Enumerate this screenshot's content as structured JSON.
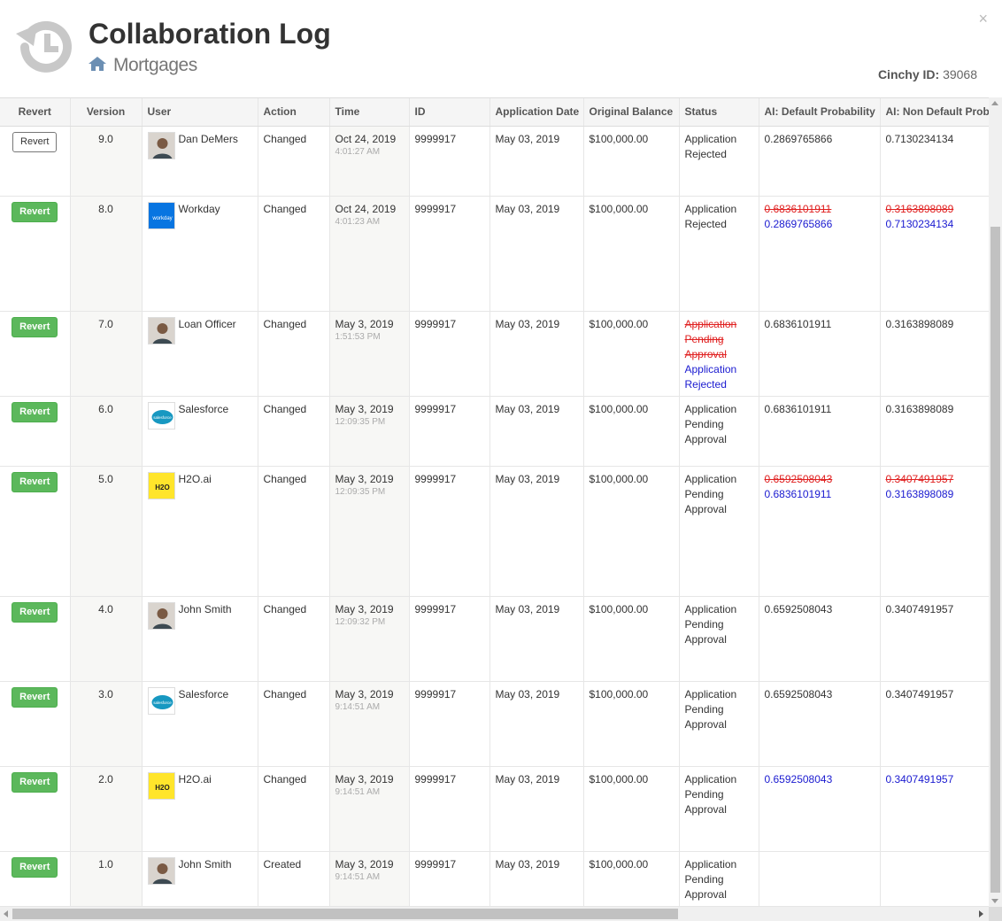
{
  "header": {
    "title": "Collaboration Log",
    "subtitle": "Mortgages",
    "close_label": "×",
    "cinchy_id_label": "Cinchy ID:",
    "cinchy_id_value": "39068"
  },
  "table": {
    "columns": [
      "Revert",
      "Version",
      "User",
      "Action",
      "Time",
      "ID",
      "Application Date",
      "Original Balance",
      "Status",
      "AI: Default Probability",
      "AI: Non Default Probability"
    ],
    "rows": [
      {
        "revert": "Revert",
        "revert_style": "default",
        "version": "9.0",
        "user": "Dan DeMers",
        "avatar": "person",
        "action": "Changed",
        "date": "Oct 24, 2019",
        "time": "4:01:27 AM",
        "id": "9999917",
        "app_date": "May 03, 2019",
        "balance": "$100,000.00",
        "status": [
          {
            "text": "Application Rejected",
            "style": "plain"
          }
        ],
        "default_prob": [
          {
            "text": "0.2869765866",
            "style": "plain"
          }
        ],
        "non_default_prob": [
          {
            "text": "0.7130234134",
            "style": "plain"
          }
        ]
      },
      {
        "revert": "Revert",
        "revert_style": "success",
        "version": "8.0",
        "user": "Workday",
        "avatar": "workday",
        "action": "Changed",
        "date": "Oct 24, 2019",
        "time": "4:01:23 AM",
        "id": "9999917",
        "app_date": "May 03, 2019",
        "balance": "$100,000.00",
        "status": [
          {
            "text": "Application Rejected",
            "style": "plain"
          }
        ],
        "default_prob": [
          {
            "text": "0.6836101911",
            "style": "old"
          },
          {
            "text": "0.2869765866",
            "style": "new"
          }
        ],
        "non_default_prob": [
          {
            "text": "0.3163898089",
            "style": "old"
          },
          {
            "text": "0.7130234134",
            "style": "new"
          }
        ]
      },
      {
        "revert": "Revert",
        "revert_style": "success",
        "version": "7.0",
        "user": "Loan Officer",
        "avatar": "person",
        "action": "Changed",
        "date": "May 3, 2019",
        "time": "1:51:53 PM",
        "id": "9999917",
        "app_date": "May 03, 2019",
        "balance": "$100,000.00",
        "status": [
          {
            "text": "Application Pending Approval",
            "style": "old"
          },
          {
            "text": "Application Rejected",
            "style": "new"
          }
        ],
        "default_prob": [
          {
            "text": "0.6836101911",
            "style": "plain"
          }
        ],
        "non_default_prob": [
          {
            "text": "0.3163898089",
            "style": "plain"
          }
        ]
      },
      {
        "revert": "Revert",
        "revert_style": "success",
        "version": "6.0",
        "user": "Salesforce",
        "avatar": "salesforce",
        "action": "Changed",
        "date": "May 3, 2019",
        "time": "12:09:35 PM",
        "id": "9999917",
        "app_date": "May 03, 2019",
        "balance": "$100,000.00",
        "status": [
          {
            "text": "Application Pending Approval",
            "style": "plain"
          }
        ],
        "default_prob": [
          {
            "text": "0.6836101911",
            "style": "plain"
          }
        ],
        "non_default_prob": [
          {
            "text": "0.3163898089",
            "style": "plain"
          }
        ]
      },
      {
        "revert": "Revert",
        "revert_style": "success",
        "version": "5.0",
        "user": "H2O.ai",
        "avatar": "h2o",
        "action": "Changed",
        "date": "May 3, 2019",
        "time": "12:09:35 PM",
        "id": "9999917",
        "app_date": "May 03, 2019",
        "balance": "$100,000.00",
        "status": [
          {
            "text": "Application Pending Approval",
            "style": "plain"
          }
        ],
        "default_prob": [
          {
            "text": "0.6592508043",
            "style": "old"
          },
          {
            "text": "0.6836101911",
            "style": "new"
          }
        ],
        "non_default_prob": [
          {
            "text": "0.3407491957",
            "style": "old"
          },
          {
            "text": "0.3163898089",
            "style": "new"
          }
        ]
      },
      {
        "revert": "Revert",
        "revert_style": "success",
        "version": "4.0",
        "user": "John Smith",
        "avatar": "person",
        "action": "Changed",
        "date": "May 3, 2019",
        "time": "12:09:32 PM",
        "id": "9999917",
        "app_date": "May 03, 2019",
        "balance": "$100,000.00",
        "status": [
          {
            "text": "Application Pending Approval",
            "style": "plain"
          }
        ],
        "default_prob": [
          {
            "text": "0.6592508043",
            "style": "plain"
          }
        ],
        "non_default_prob": [
          {
            "text": "0.3407491957",
            "style": "plain"
          }
        ]
      },
      {
        "revert": "Revert",
        "revert_style": "success",
        "version": "3.0",
        "user": "Salesforce",
        "avatar": "salesforce",
        "action": "Changed",
        "date": "May 3, 2019",
        "time": "9:14:51 AM",
        "id": "9999917",
        "app_date": "May 03, 2019",
        "balance": "$100,000.00",
        "status": [
          {
            "text": "Application Pending Approval",
            "style": "plain"
          }
        ],
        "default_prob": [
          {
            "text": "0.6592508043",
            "style": "plain"
          }
        ],
        "non_default_prob": [
          {
            "text": "0.3407491957",
            "style": "plain"
          }
        ]
      },
      {
        "revert": "Revert",
        "revert_style": "success",
        "version": "2.0",
        "user": "H2O.ai",
        "avatar": "h2o",
        "action": "Changed",
        "date": "May 3, 2019",
        "time": "9:14:51 AM",
        "id": "9999917",
        "app_date": "May 03, 2019",
        "balance": "$100,000.00",
        "status": [
          {
            "text": "Application Pending Approval",
            "style": "plain"
          }
        ],
        "default_prob": [
          {
            "text": "0.6592508043",
            "style": "new"
          }
        ],
        "non_default_prob": [
          {
            "text": "0.3407491957",
            "style": "new"
          }
        ]
      },
      {
        "revert": "Revert",
        "revert_style": "success",
        "version": "1.0",
        "user": "John Smith",
        "avatar": "person",
        "action": "Created",
        "date": "May 3, 2019",
        "time": "9:14:51 AM",
        "id": "9999917",
        "app_date": "May 03, 2019",
        "balance": "$100,000.00",
        "status": [
          {
            "text": "Application Pending Approval",
            "style": "plain"
          }
        ],
        "default_prob": [],
        "non_default_prob": []
      }
    ]
  },
  "colors": {
    "revert_green": "#5cb85c",
    "changed_old": "#e02020",
    "changed_new": "#1a1ad0"
  },
  "icons": {
    "logo": "history-icon",
    "breadcrumb": "home-icon",
    "close": "close-icon"
  }
}
